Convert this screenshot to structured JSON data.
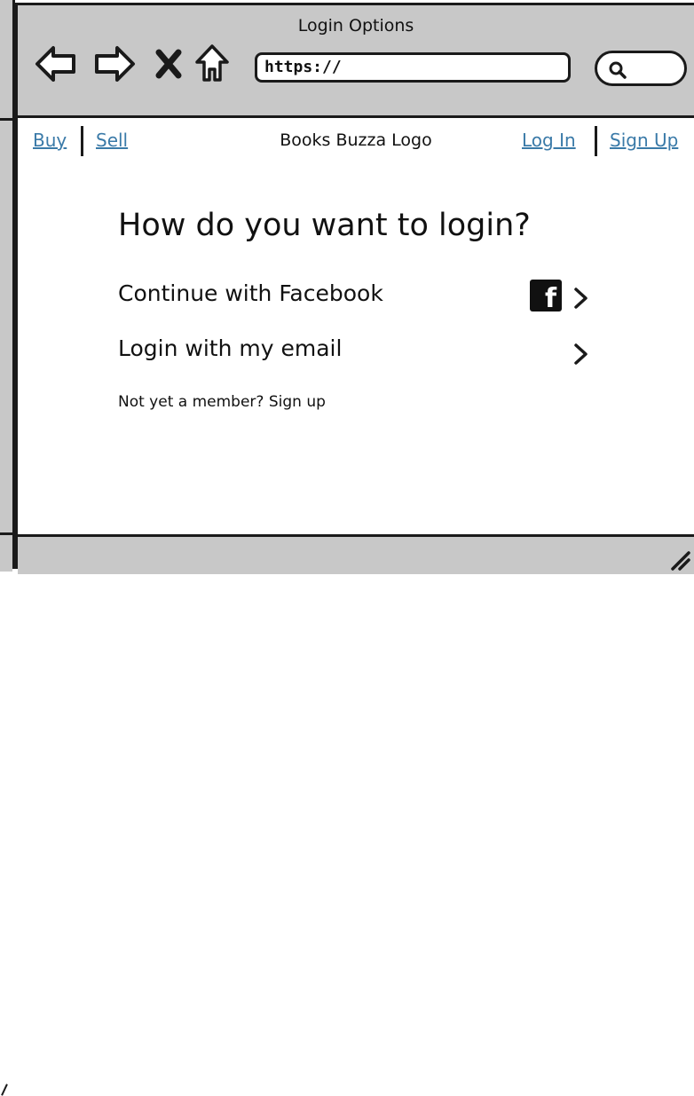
{
  "window": {
    "title": "Login Options"
  },
  "toolbar": {
    "back_icon": "back-arrow-icon",
    "forward_icon": "forward-arrow-icon",
    "stop_icon": "close-icon",
    "home_icon": "home-icon",
    "url_value": "https://",
    "search_icon": "search-icon"
  },
  "nav": {
    "buy": "Buy",
    "sell": "Sell",
    "logo": "Books Buzza Logo",
    "login": "Log In",
    "signup": "Sign Up"
  },
  "main": {
    "heading": "How do you want to login?",
    "options": [
      {
        "label": "Continue with Facebook",
        "icon": "facebook-icon"
      },
      {
        "label": "Login with my email"
      }
    ],
    "signup_prompt": "Not yet a member? Sign up"
  },
  "colors": {
    "chrome": "#c8c8c8",
    "link": "#3a7aa8",
    "border": "#1a1a1a"
  }
}
